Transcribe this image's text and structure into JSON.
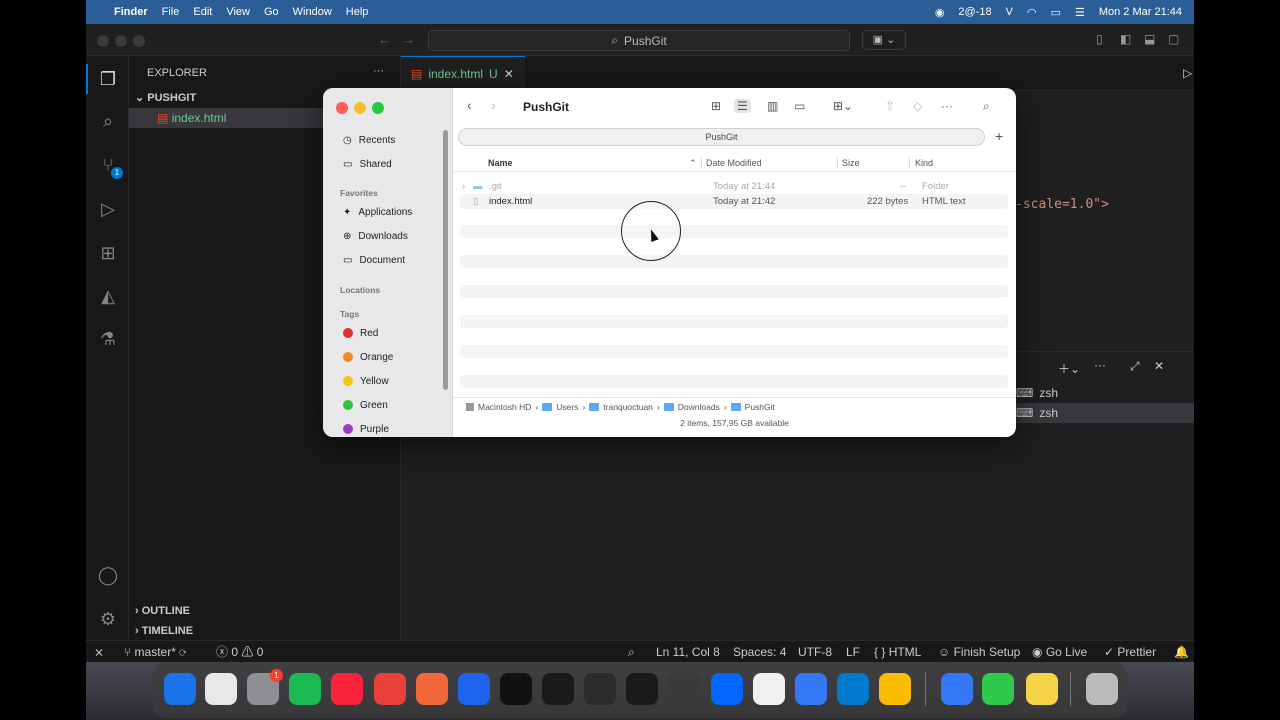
{
  "menubar": {
    "app": "Finder",
    "items": [
      "File",
      "Edit",
      "View",
      "Go",
      "Window",
      "Help"
    ],
    "status": "2@-18",
    "v": "V",
    "datetime": "Mon 2 Mar  21:44"
  },
  "vscode": {
    "command_center": "PushGit",
    "explorer_title": "EXPLORER",
    "project": "PUSHGIT",
    "file": "index.html",
    "tab": {
      "label": "index.html",
      "status": "U"
    },
    "code_fragment": "-scale=1.0\">",
    "outline": "OUTLINE",
    "timeline": "TIMELINE",
    "source_control_badge": "1",
    "terminals": [
      "zsh",
      "zsh"
    ]
  },
  "statusbar": {
    "branch": "master*",
    "errors": "0",
    "warnings": "0",
    "position": "Ln 11, Col 8",
    "spaces": "Spaces: 4",
    "encoding": "UTF-8",
    "eol": "LF",
    "language": "HTML",
    "finish_setup": "Finish Setup",
    "go_live": "Go Live",
    "prettier": "Prettier"
  },
  "finder": {
    "title": "PushGit",
    "tab_title": "PushGit",
    "sidebar": {
      "top": [
        "Recents",
        "Shared"
      ],
      "favorites_label": "Favorites",
      "favorites": [
        "Applications",
        "Downloads",
        "Document"
      ],
      "locations_label": "Locations",
      "tags_label": "Tags",
      "tags": [
        {
          "name": "Red",
          "color": "#e0302b"
        },
        {
          "name": "Orange",
          "color": "#f08a24"
        },
        {
          "name": "Yellow",
          "color": "#f5c518"
        },
        {
          "name": "Green",
          "color": "#34c23f"
        },
        {
          "name": "Purple",
          "color": "#9b3fc6"
        }
      ]
    },
    "columns": [
      "Name",
      "Date Modified",
      "Size",
      "Kind"
    ],
    "rows": [
      {
        "name": ".git",
        "date": "Today at 21:44",
        "size": "--",
        "kind": "Folder"
      },
      {
        "name": "index.html",
        "date": "Today at 21:42",
        "size": "222 bytes",
        "kind": "HTML text"
      }
    ],
    "path": [
      "Macintosh HD",
      "Users",
      "tranquoctuan",
      "Downloads",
      "PushGit"
    ],
    "status": "2 items, 157,95 GB available"
  },
  "dock": {
    "badge": "1",
    "colors": [
      "#1a73e8",
      "#e8e8e8",
      "#8e8e93",
      "#1db954",
      "#fa243c",
      "#e8413a",
      "#f2683a",
      "#1d63ed",
      "#111111",
      "#1a1a1a",
      "#2a2a2a",
      "#1a1a1a",
      "#3a3a3a",
      "#0068ff",
      "#f0f0f0",
      "#3478f6",
      "#007acc",
      "#fbbc04",
      "#3478f6",
      "#2fc94d",
      "#f5d547",
      "#bbbbbb"
    ]
  }
}
